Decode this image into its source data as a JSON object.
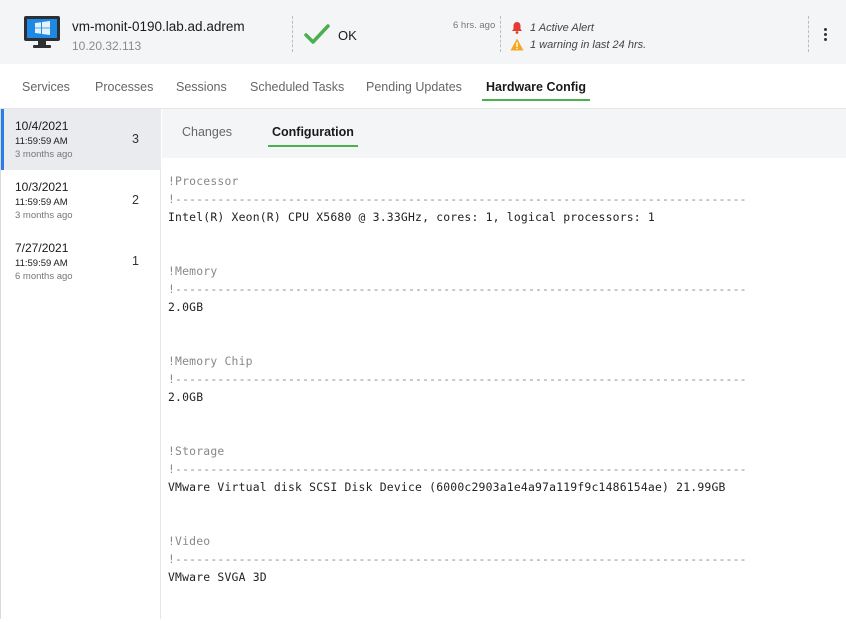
{
  "header": {
    "hostname": "vm-monit-0190.lab.ad.adrem",
    "ip": "10.20.32.113",
    "status": "OK",
    "updated_ago": "6 hrs. ago",
    "alert_text": "1 Active Alert",
    "warning_text": "1 warning in last 24 hrs.",
    "colors": {
      "ok": "#4caf50",
      "alert": "#e53935",
      "warning": "#f5a623"
    }
  },
  "tabs": [
    {
      "label": "Services"
    },
    {
      "label": "Processes"
    },
    {
      "label": "Sessions"
    },
    {
      "label": "Scheduled Tasks"
    },
    {
      "label": "Pending Updates"
    },
    {
      "label": "Hardware Config",
      "active": true
    }
  ],
  "snapshots": [
    {
      "date": "10/4/2021",
      "time": "11:59:59 AM",
      "ago": "3 months ago",
      "count": "3",
      "selected": true
    },
    {
      "date": "10/3/2021",
      "time": "11:59:59 AM",
      "ago": "3 months ago",
      "count": "2"
    },
    {
      "date": "7/27/2021",
      "time": "11:59:59 AM",
      "ago": "6 months ago",
      "count": "1"
    }
  ],
  "subtabs": [
    {
      "label": "Changes"
    },
    {
      "label": "Configuration",
      "active": true
    }
  ],
  "config": {
    "rule": "!---------------------------------------------------------------------------------",
    "sections": [
      {
        "title": "!Processor",
        "value": "Intel(R) Xeon(R) CPU X5680 @ 3.33GHz, cores: 1, logical processors: 1"
      },
      {
        "title": "!Memory",
        "value": "2.0GB"
      },
      {
        "title": "!Memory Chip",
        "value": "2.0GB"
      },
      {
        "title": "!Storage",
        "value": "VMware Virtual disk SCSI Disk Device (6000c2903a1e4a97a119f9c1486154ae) 21.99GB"
      },
      {
        "title": "!Video",
        "value": "VMware SVGA 3D"
      }
    ]
  }
}
